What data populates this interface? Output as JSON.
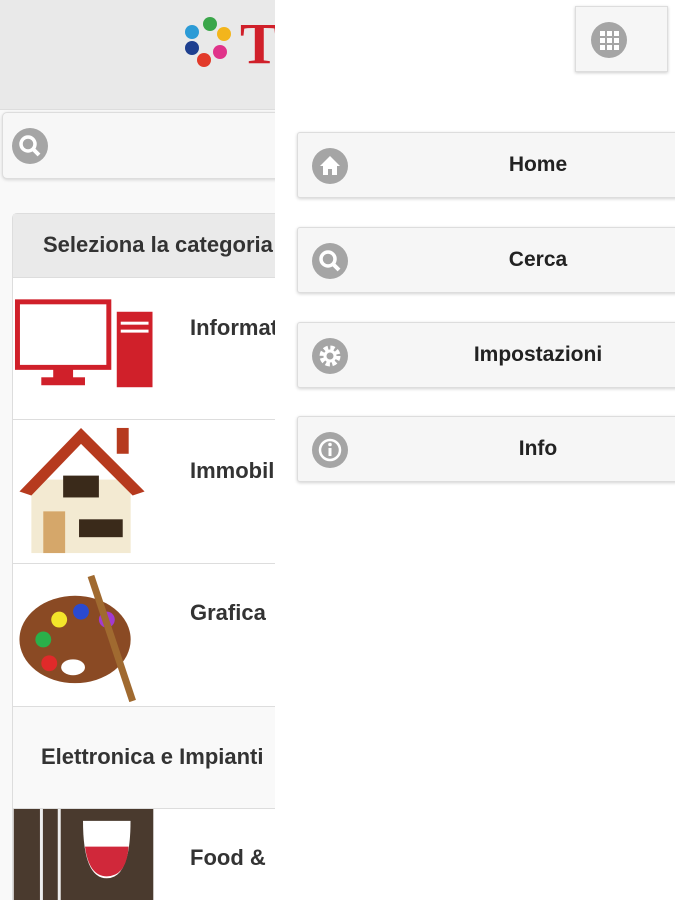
{
  "header": {
    "logo_text": "T"
  },
  "search": {
    "icon": "search-icon"
  },
  "list": {
    "heading": "Seleziona la categoria",
    "items": [
      {
        "label": "Informatica",
        "icon": "computer-image"
      },
      {
        "label": "Immobiliare",
        "icon": "house-image"
      },
      {
        "label": "Grafica",
        "icon": "palette-image"
      },
      {
        "label": "Elettronica e Impianti"
      },
      {
        "label": "Food &",
        "icon": "food-wine-image"
      }
    ]
  },
  "panel": {
    "grid_icon": "grid-icon",
    "menu": [
      {
        "label": "Home",
        "icon": "home-icon"
      },
      {
        "label": "Cerca",
        "icon": "search-icon"
      },
      {
        "label": "Impostazioni",
        "icon": "gear-icon"
      },
      {
        "label": "Info",
        "icon": "info-icon"
      }
    ]
  }
}
